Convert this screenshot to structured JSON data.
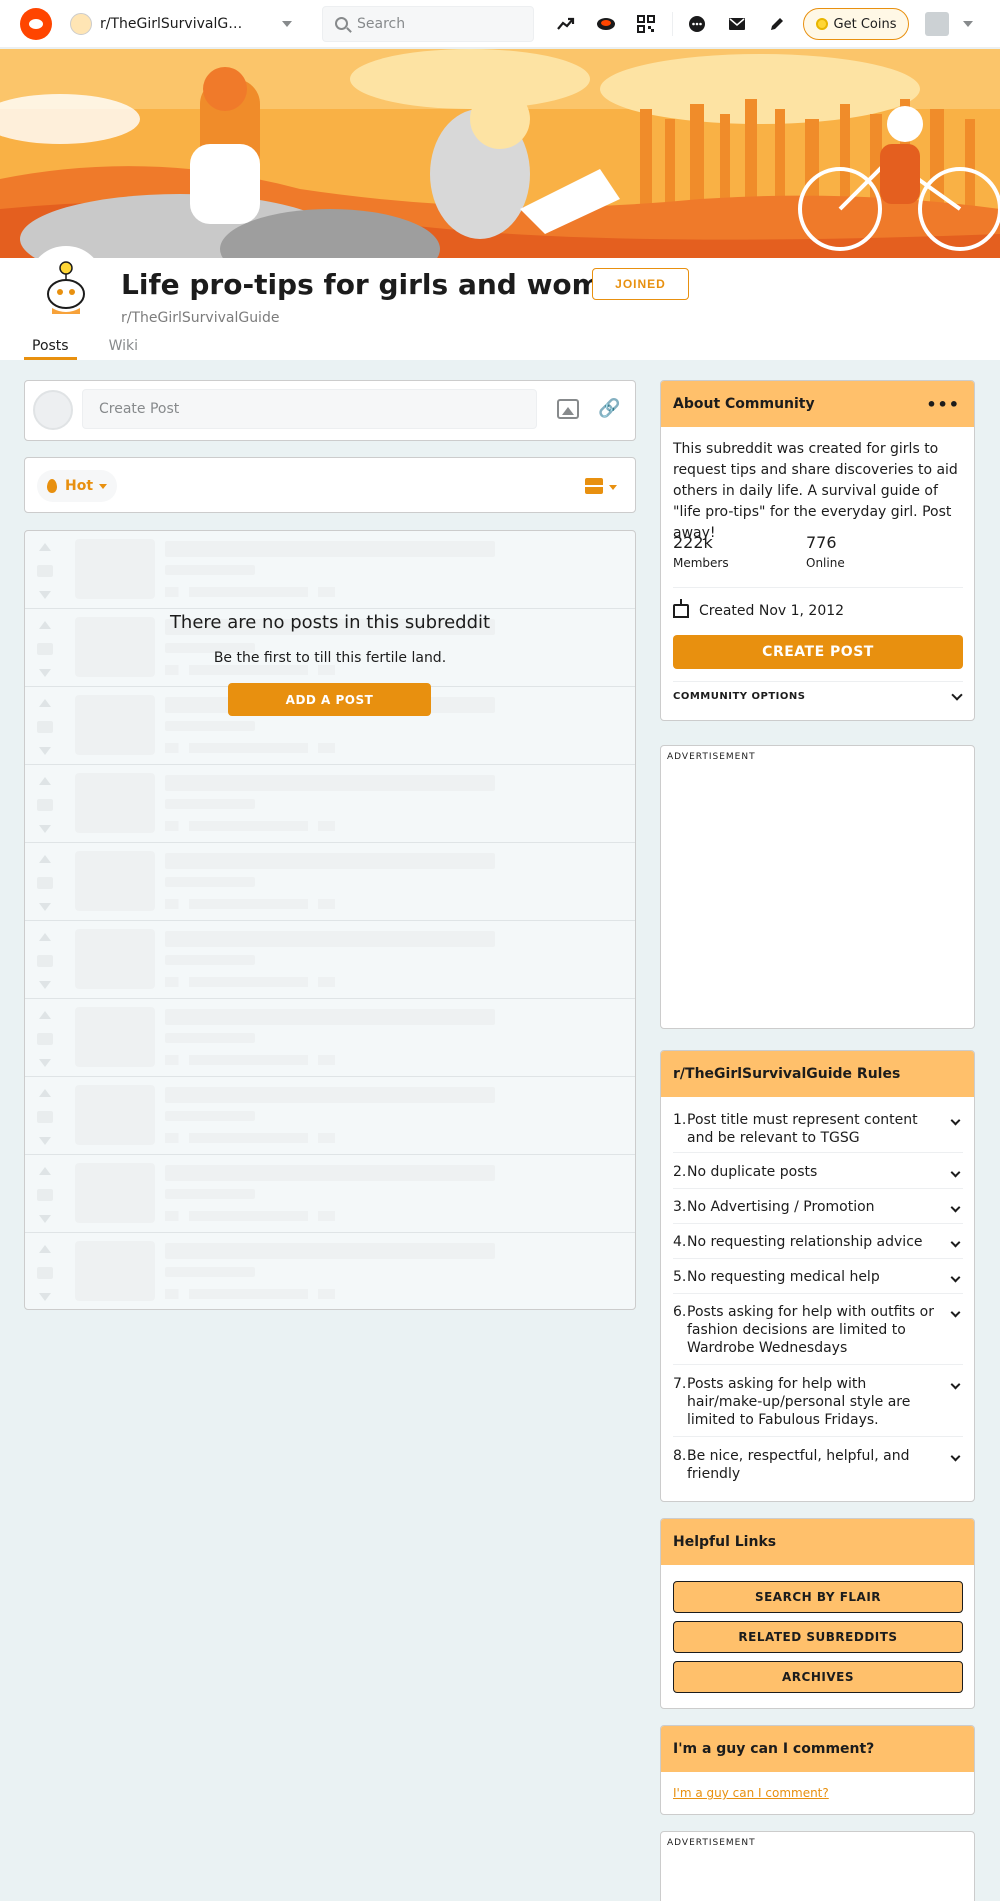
{
  "header": {
    "community": "r/TheGirlSurvivalGui...",
    "search_placeholder": "Search",
    "get_coins": "Get Coins"
  },
  "community": {
    "title": "Life pro-tips for girls and women.",
    "name": "r/TheGirlSurvivalGuide",
    "joined_label": "JOINED",
    "tabs": [
      "Posts",
      "Wiki"
    ]
  },
  "feed": {
    "create_post_placeholder": "Create Post",
    "sort_label": "Hot",
    "empty_title": "There are no posts in this subreddit",
    "empty_sub": "Be the first to till this fertile land.",
    "add_post": "ADD A POST"
  },
  "about": {
    "heading": "About Community",
    "description": "This subreddit was created for girls to request tips and share discoveries to aid others in daily life. A survival guide of \"life pro-tips\" for the everyday girl. Post away!",
    "members_count": "222k",
    "members_label": "Members",
    "online_count": "776",
    "online_label": "Online",
    "created": "Created Nov 1, 2012",
    "create_post": "CREATE POST",
    "community_options": "COMMUNITY OPTIONS"
  },
  "ads": {
    "label": "ADVERTISEMENT"
  },
  "rules": {
    "heading": "r/TheGirlSurvivalGuide Rules",
    "items": [
      {
        "num": "1.",
        "text": "Post title must represent content and be relevant to TGSG"
      },
      {
        "num": "2.",
        "text": "No duplicate posts"
      },
      {
        "num": "3.",
        "text": "No Advertising / Promotion"
      },
      {
        "num": "4.",
        "text": "No requesting relationship advice"
      },
      {
        "num": "5.",
        "text": "No requesting medical help"
      },
      {
        "num": "6.",
        "text": "Posts asking for help with outfits or fashion decisions are limited to Wardrobe Wednesdays"
      },
      {
        "num": "7.",
        "text": "Posts asking for help with hair/make-up/personal style are limited to Fabulous Fridays."
      },
      {
        "num": "8.",
        "text": "Be nice, respectful, helpful, and friendly"
      }
    ]
  },
  "helpful_links": {
    "heading": "Helpful Links",
    "buttons": [
      "SEARCH BY FLAIR",
      "RELATED SUBREDDITS",
      "ARCHIVES"
    ]
  },
  "guy": {
    "heading": "I'm a guy can I comment?",
    "link": "I'm a guy can I comment?"
  },
  "colors": {
    "accent": "#e8900f",
    "sidebar_header": "#ffc06b",
    "banner": "#f7a23a"
  }
}
